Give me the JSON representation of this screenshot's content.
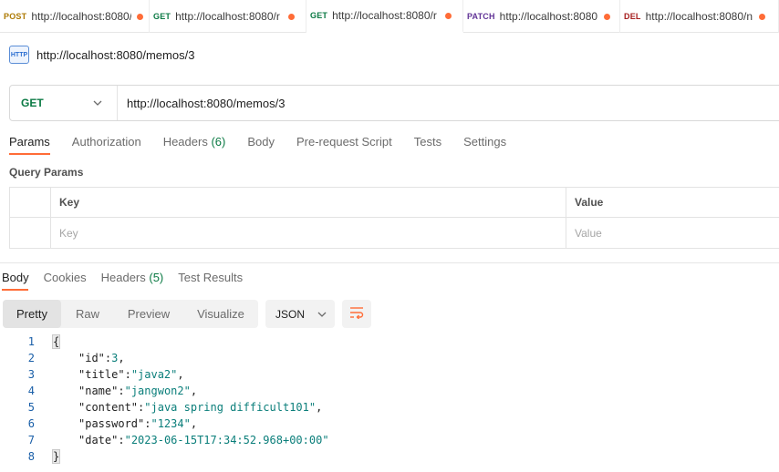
{
  "tabs": [
    {
      "method": "POST",
      "url": "http://localhost:8080/",
      "method_color": "#ad7a03"
    },
    {
      "method": "GET",
      "url": "http://localhost:8080/r",
      "method_color": "#0b7a44"
    },
    {
      "method": "GET",
      "url": "http://localhost:8080/r",
      "method_color": "#0b7a44"
    },
    {
      "method": "PATCH",
      "url": "http://localhost:8080",
      "method_color": "#623497"
    },
    {
      "method": "DEL",
      "url": "http://localhost:8080/n",
      "method_color": "#a61e1e"
    }
  ],
  "request": {
    "icon_label": "HTTP",
    "title": "http://localhost:8080/memos/3",
    "method": "GET",
    "url": "http://localhost:8080/memos/3"
  },
  "request_tabs": {
    "params": "Params",
    "authorization": "Authorization",
    "headers": "Headers",
    "headers_count": "(6)",
    "body": "Body",
    "prerequest": "Pre-request Script",
    "tests": "Tests",
    "settings": "Settings"
  },
  "query_params": {
    "label": "Query Params",
    "col_key": "Key",
    "col_value": "Value",
    "placeholder_key": "Key",
    "placeholder_value": "Value"
  },
  "response_tabs": {
    "body": "Body",
    "cookies": "Cookies",
    "headers": "Headers",
    "headers_count": "(5)",
    "test_results": "Test Results"
  },
  "toolbar": {
    "pretty": "Pretty",
    "raw": "Raw",
    "preview": "Preview",
    "visualize": "Visualize",
    "format": "JSON"
  },
  "response_body": {
    "id_key": "\"id\"",
    "id_val": "3",
    "title_key": "\"title\"",
    "title_val": "\"java2\"",
    "name_key": "\"name\"",
    "name_val": "\"jangwon2\"",
    "content_key": "\"content\"",
    "content_val": "\"java spring difficult101\"",
    "password_key": "\"password\"",
    "password_val": "\"1234\"",
    "date_key": "\"date\"",
    "date_val": "\"2023-06-15T17:34:52.968+00:00\""
  },
  "line_numbers": [
    "1",
    "2",
    "3",
    "4",
    "5",
    "6",
    "7",
    "8"
  ]
}
